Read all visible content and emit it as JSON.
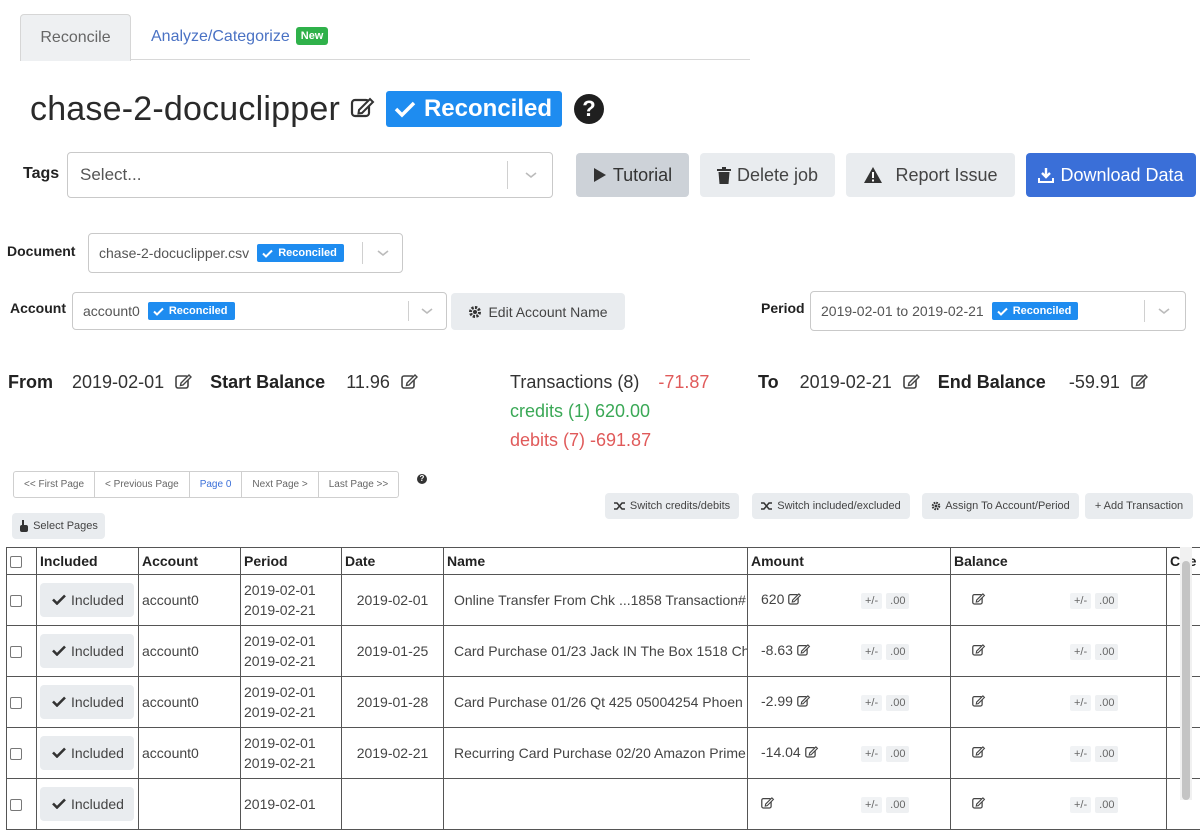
{
  "tabs": [
    {
      "label": "Reconcile",
      "active": true
    },
    {
      "label": "Analyze/Categorize",
      "active": false,
      "badge": "New"
    }
  ],
  "title": {
    "text": "chase-2-docuclipper",
    "status_badge": "Reconciled",
    "help": "?"
  },
  "tags": {
    "label": "Tags",
    "placeholder": "Select..."
  },
  "toolbar": {
    "tutorial": "Tutorial",
    "delete_job": "Delete job",
    "report_issue": "Report Issue",
    "download_data": "Download Data"
  },
  "document": {
    "label": "Document",
    "value": "chase-2-docuclipper.csv",
    "badge": "Reconciled"
  },
  "account": {
    "label": "Account",
    "value": "account0",
    "badge": "Reconciled",
    "edit_button": "Edit Account Name"
  },
  "period": {
    "label": "Period",
    "value": "2019-02-01 to 2019-02-21",
    "badge": "Reconciled"
  },
  "summary": {
    "from_label": "From",
    "from_value": "2019-02-01",
    "start_balance_label": "Start Balance",
    "start_balance_value": "11.96",
    "transactions_text": "Transactions (8)",
    "transactions_value": "-71.87",
    "credits_text": "credits (1) 620.00",
    "debits_text": "debits (7) -691.87",
    "to_label": "To",
    "to_value": "2019-02-21",
    "end_balance_label": "End Balance",
    "end_balance_value": "-59.91"
  },
  "pager": {
    "first": "<< First Page",
    "prev": "< Previous Page",
    "current": "Page 0",
    "next": "Next Page >",
    "last": "Last Page >>",
    "select_pages": "Select Pages"
  },
  "actions": {
    "switch_credits_debits": "Switch credits/debits",
    "switch_included_excluded": "Switch included/excluded",
    "assign": "Assign To Account/Period",
    "add_transaction": "+ Add Transaction"
  },
  "table": {
    "headers": [
      "Included",
      "Account",
      "Period",
      "Date",
      "Name",
      "Amount",
      "Balance",
      "Che"
    ],
    "rows": [
      {
        "included": "Included",
        "account": "account0",
        "period_start": "2019-02-01",
        "period_end": "2019-02-21",
        "date": "2019-02-01",
        "name": "Online Transfer From Chk ...1858 Transaction#",
        "amount": "620",
        "pm": "+/-",
        "decimals": ".00"
      },
      {
        "included": "Included",
        "account": "account0",
        "period_start": "2019-02-01",
        "period_end": "2019-02-21",
        "date": "2019-01-25",
        "name": "Card Purchase 01/23 Jack IN The Box 1518 Ch",
        "amount": "-8.63",
        "pm": "+/-",
        "decimals": ".00"
      },
      {
        "included": "Included",
        "account": "account0",
        "period_start": "2019-02-01",
        "period_end": "2019-02-21",
        "date": "2019-01-28",
        "name": "Card Purchase 01/26 Qt 425 05004254 Phoen",
        "amount": "-2.99",
        "pm": "+/-",
        "decimals": ".00"
      },
      {
        "included": "Included",
        "account": "account0",
        "period_start": "2019-02-01",
        "period_end": "2019-02-21",
        "date": "2019-02-21",
        "name": "Recurring Card Purchase 02/20 Amazon Prime",
        "amount": "-14.04",
        "pm": "+/-",
        "decimals": ".00"
      },
      {
        "included": "Included",
        "account": "",
        "period_start": "2019-02-01",
        "period_end": "",
        "date": "",
        "name": "",
        "amount": "",
        "pm": "+/-",
        "decimals": ".00"
      }
    ]
  },
  "colors": {
    "accent_blue": "#1e8cf0",
    "primary_button": "#3a6fd8",
    "link": "#4a72c4",
    "new_badge": "#2fb14a",
    "negative": "#e05a5a",
    "positive": "#3aa856"
  }
}
